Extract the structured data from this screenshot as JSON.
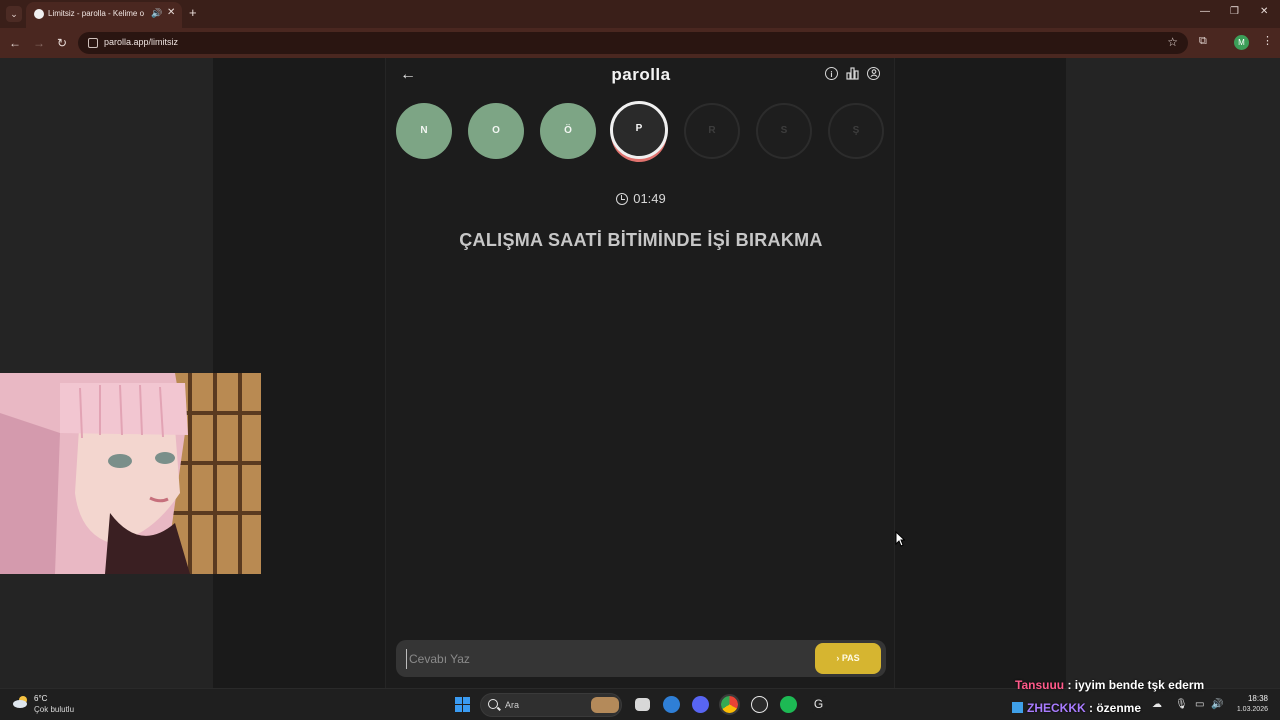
{
  "browser": {
    "tab_title": "Limitsiz - parolla - Kelime o",
    "url": "parolla.app/limitsiz",
    "profile_initial": "M"
  },
  "game": {
    "logo": "parolla",
    "letters": [
      {
        "char": "N",
        "state": "done"
      },
      {
        "char": "O",
        "state": "done"
      },
      {
        "char": "Ö",
        "state": "done"
      },
      {
        "char": "P",
        "state": "current"
      },
      {
        "char": "R",
        "state": "pending"
      },
      {
        "char": "S",
        "state": "pending"
      },
      {
        "char": "Ş",
        "state": "pending"
      }
    ],
    "timer": "01:49",
    "question": "ÇALIŞMA SAATİ BİTİMİNDE İŞİ BIRAKMA",
    "answer_placeholder": "Cevabı Yaz",
    "pass_label": "PAS",
    "colors": {
      "done": "#7da585",
      "pass": "#d6b530",
      "current_ring": "#e0726e"
    }
  },
  "chat": [
    {
      "user": "Tansuuu",
      "user_color": "#ff5a8a",
      "message": ": iyyim bende tşk ederm"
    },
    {
      "user": "ZHECKKK",
      "user_color": "#a97cff",
      "message": ": özenme"
    }
  ],
  "taskbar": {
    "weather_temp": "6°C",
    "weather_desc": "Çok bulutlu",
    "search_label": "Ara",
    "time": "18:38",
    "date": "1.03.2026"
  }
}
